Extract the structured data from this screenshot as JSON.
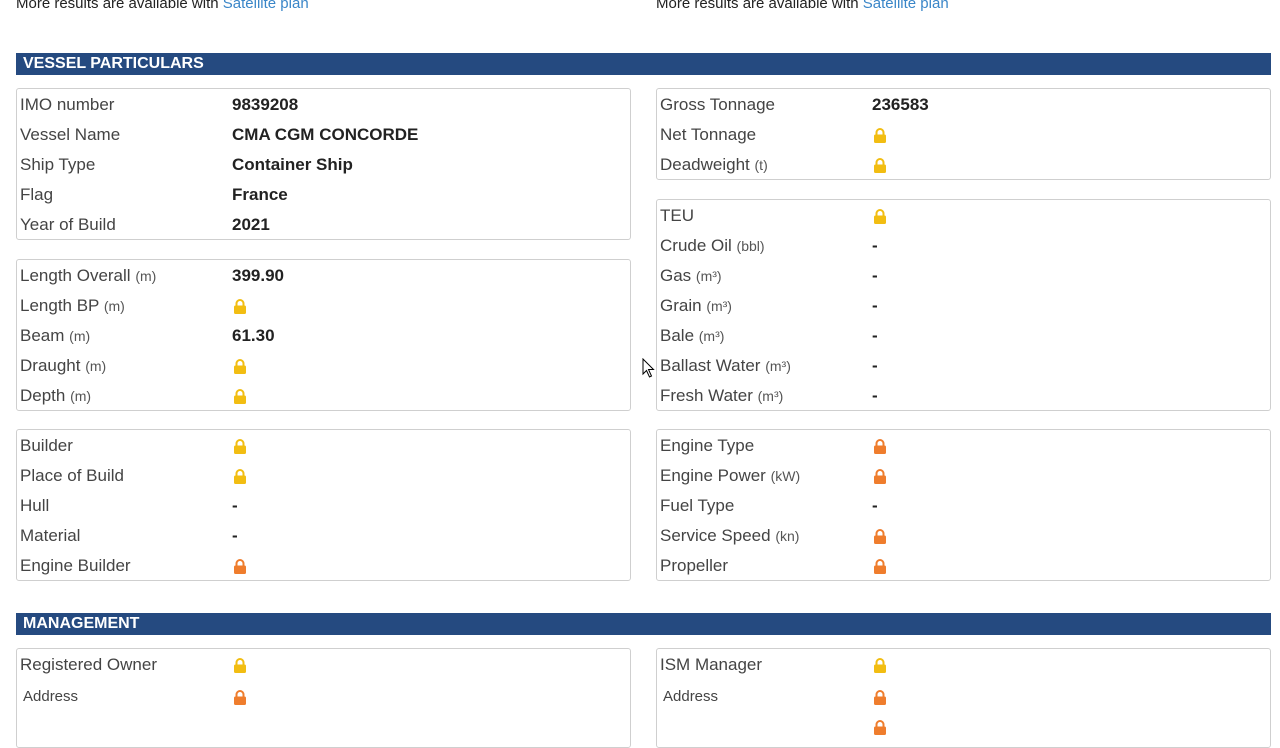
{
  "top_notice": {
    "prefix": "More results are available with",
    "link": "Satellite plan"
  },
  "colors": {
    "header_bg": "#254a80",
    "lock_yellow": "#f2bd12",
    "lock_orange": "#ef7d2d",
    "link": "#3a86c8"
  },
  "vessel_particulars": {
    "title": "VESSEL PARTICULARS",
    "identity": [
      {
        "label": "IMO number",
        "unit": "",
        "value": "9839208",
        "lock": ""
      },
      {
        "label": "Vessel Name",
        "unit": "",
        "value": "CMA CGM CONCORDE",
        "lock": ""
      },
      {
        "label": "Ship Type",
        "unit": "",
        "value": "Container Ship",
        "lock": ""
      },
      {
        "label": "Flag",
        "unit": "",
        "value": "France",
        "lock": ""
      },
      {
        "label": "Year of Build",
        "unit": "",
        "value": "2021",
        "lock": ""
      }
    ],
    "dimensions": [
      {
        "label": "Length Overall",
        "unit": "(m)",
        "value": "399.90",
        "lock": ""
      },
      {
        "label": "Length BP",
        "unit": "(m)",
        "value": "",
        "lock": "yellow"
      },
      {
        "label": "Beam",
        "unit": "(m)",
        "value": "61.30",
        "lock": ""
      },
      {
        "label": "Draught",
        "unit": "(m)",
        "value": "",
        "lock": "yellow"
      },
      {
        "label": "Depth",
        "unit": "(m)",
        "value": "",
        "lock": "yellow"
      }
    ],
    "build": [
      {
        "label": "Builder",
        "unit": "",
        "value": "",
        "lock": "yellow"
      },
      {
        "label": "Place of Build",
        "unit": "",
        "value": "",
        "lock": "yellow"
      },
      {
        "label": "Hull",
        "unit": "",
        "value": "-",
        "lock": ""
      },
      {
        "label": "Material",
        "unit": "",
        "value": "-",
        "lock": ""
      },
      {
        "label": "Engine Builder",
        "unit": "",
        "value": "",
        "lock": "orange"
      }
    ],
    "tonnage": [
      {
        "label": "Gross Tonnage",
        "unit": "",
        "value": "236583",
        "lock": ""
      },
      {
        "label": "Net Tonnage",
        "unit": "",
        "value": "",
        "lock": "yellow"
      },
      {
        "label": "Deadweight",
        "unit": "(t)",
        "value": "",
        "lock": "yellow"
      }
    ],
    "capacity": [
      {
        "label": "TEU",
        "unit": "",
        "value": "",
        "lock": "yellow"
      },
      {
        "label": "Crude Oil",
        "unit": "(bbl)",
        "value": "-",
        "lock": ""
      },
      {
        "label": "Gas",
        "unit": "(m³)",
        "value": "-",
        "lock": ""
      },
      {
        "label": "Grain",
        "unit": "(m³)",
        "value": "-",
        "lock": ""
      },
      {
        "label": "Bale",
        "unit": "(m³)",
        "value": "-",
        "lock": ""
      },
      {
        "label": "Ballast Water",
        "unit": "(m³)",
        "value": "-",
        "lock": ""
      },
      {
        "label": "Fresh Water",
        "unit": "(m³)",
        "value": "-",
        "lock": ""
      }
    ],
    "engine": [
      {
        "label": "Engine Type",
        "unit": "",
        "value": "",
        "lock": "orange"
      },
      {
        "label": "Engine Power",
        "unit": "(kW)",
        "value": "",
        "lock": "orange"
      },
      {
        "label": "Fuel Type",
        "unit": "",
        "value": "-",
        "lock": ""
      },
      {
        "label": "Service Speed",
        "unit": "(kn)",
        "value": "",
        "lock": "orange"
      },
      {
        "label": "Propeller",
        "unit": "",
        "value": "",
        "lock": "orange"
      }
    ]
  },
  "management": {
    "title": "MANAGEMENT",
    "owner": [
      {
        "label": "Registered Owner",
        "unit": "",
        "value": "",
        "lock": "yellow"
      },
      {
        "label": "Address",
        "unit": "",
        "value": "",
        "lock": "orange",
        "small": true
      }
    ],
    "ism": [
      {
        "label": "ISM Manager",
        "unit": "",
        "value": "",
        "lock": "yellow"
      },
      {
        "label": "Address",
        "unit": "",
        "value": "",
        "lock": "orange",
        "small": true
      },
      {
        "label": "",
        "unit": "",
        "value": "",
        "lock": "orange"
      }
    ]
  }
}
